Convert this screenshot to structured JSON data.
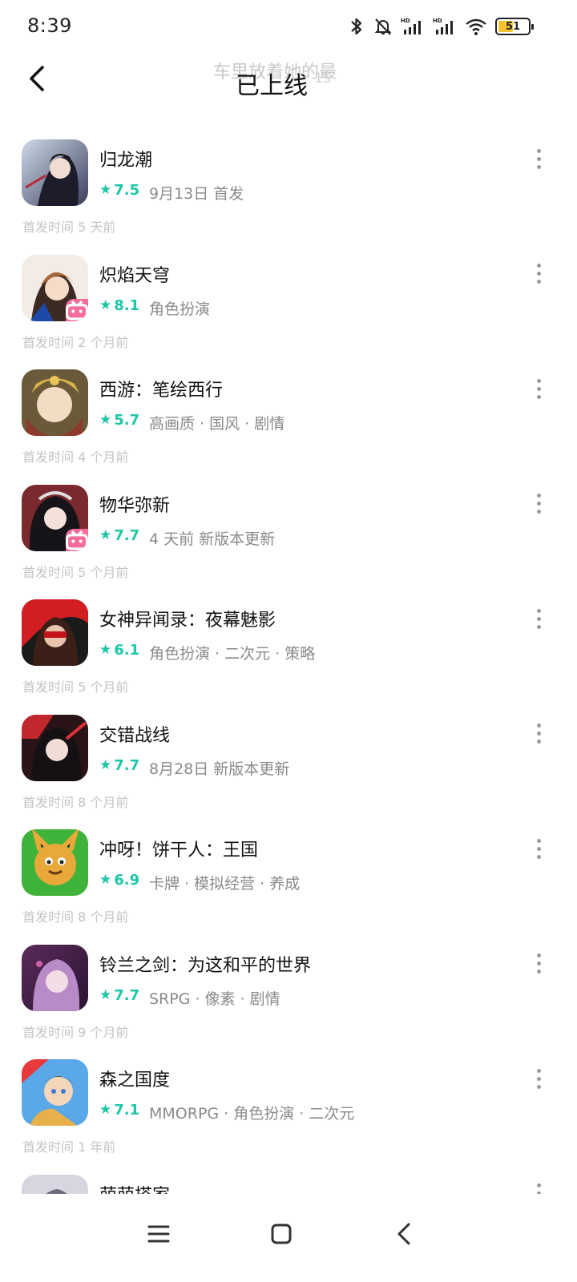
{
  "status_bar": {
    "time": "8:39",
    "battery_level": "51",
    "battery_fraction": 0.51,
    "icons": [
      "bluetooth-icon",
      "mute-bell-icon",
      "hd-signal-icon",
      "hd-signal-icon",
      "wifi-icon",
      "battery-icon"
    ]
  },
  "header": {
    "title": "已上线",
    "ghost_title": "车里放着她的最",
    "ghost_count": "15"
  },
  "games": [
    {
      "name": "归龙潮",
      "rating": "7.5",
      "meta": "9月13日 首发",
      "release": "首发时间 5 天前",
      "badge": false
    },
    {
      "name": "炽焰天穹",
      "rating": "8.1",
      "meta": "角色扮演",
      "release": "首发时间 2 个月前",
      "badge": true
    },
    {
      "name": "西游：笔绘西行",
      "rating": "5.7",
      "meta": "高画质 · 国风 · 剧情",
      "release": "首发时间 4 个月前",
      "badge": false
    },
    {
      "name": "物华弥新",
      "rating": "7.7",
      "meta": "4 天前 新版本更新",
      "release": "首发时间 5 个月前",
      "badge": true
    },
    {
      "name": "女神异闻录：夜幕魅影",
      "rating": "6.1",
      "meta": "角色扮演 · 二次元 · 策略",
      "release": "首发时间 5 个月前",
      "badge": false
    },
    {
      "name": "交错战线",
      "rating": "7.7",
      "meta": "8月28日 新版本更新",
      "release": "首发时间 8 个月前",
      "badge": false
    },
    {
      "name": "冲呀！饼干人：王国",
      "rating": "6.9",
      "meta": "卡牌 · 模拟经营 · 养成",
      "release": "首发时间 8 个月前",
      "badge": false
    },
    {
      "name": "铃兰之剑：为这和平的世界",
      "rating": "7.7",
      "meta": "SRPG · 像素 · 剧情",
      "release": "首发时间 9 个月前",
      "badge": false
    },
    {
      "name": "森之国度",
      "rating": "7.1",
      "meta": "MMORPG · 角色扮演 · 二次元",
      "release": "首发时间 1 年前",
      "badge": false
    },
    {
      "name": "萌萌搭家",
      "rating": "",
      "meta": "",
      "release": "",
      "badge": false
    }
  ],
  "colors": {
    "accent": "#1cc7a6",
    "meta_text": "#8a8a8a",
    "release_text": "#c4c4c4",
    "badge": "#f56c9a"
  }
}
